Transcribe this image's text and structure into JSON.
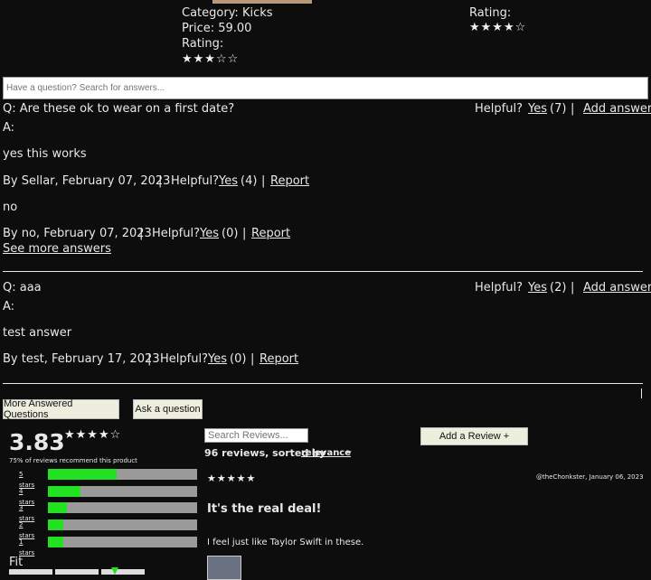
{
  "product": {
    "category": "Category: Kicks",
    "price": "Price: 59.00",
    "rating_label": "Rating:",
    "rating_stars": "★★★☆☆"
  },
  "related": {
    "rating_label": "Rating:",
    "rating_stars": "★★★★☆"
  },
  "qa_search": {
    "placeholder": "Have a question? Search for answers..."
  },
  "questions": [
    {
      "q": "Q: Are these ok to wear on a first date?",
      "helpful": "Helpful?",
      "yes": "Yes",
      "count": "(7)",
      "sep": "|",
      "add": "Add answer",
      "a_label": "A:",
      "answers": [
        {
          "body": "yes this works",
          "by": "By  Sellar, February 07, 2023",
          "sep1": "|",
          "helpful": "Helpful?",
          "yes": "Yes",
          "count": "(4)",
          "sep2": "|",
          "report": "Report"
        },
        {
          "body": "no",
          "by": "By  no, February 07, 2023",
          "sep1": "|",
          "helpful": "Helpful?",
          "yes": "Yes",
          "count": "(0)",
          "sep2": "|",
          "report": "Report"
        }
      ],
      "more": "See more answers"
    },
    {
      "q": "Q: aaa",
      "helpful": "Helpful?",
      "yes": "Yes",
      "count": "(2)",
      "sep": "|",
      "add": "Add answer",
      "a_label": "A:",
      "answers": [
        {
          "body": "test answer",
          "by": "By  test, February 17, 2023",
          "sep1": "|",
          "helpful": "Helpful?",
          "yes": "Yes",
          "count": "(0)",
          "sep2": "|",
          "report": "Report"
        }
      ]
    }
  ],
  "buttons": {
    "more_questions": "More Answered Questions",
    "ask": "Ask a question",
    "add_review": "Add a Review +"
  },
  "ratings": {
    "average": "3.83",
    "stars": "★★★★☆",
    "recommend": "75% of reviews recommend this product",
    "breakdown": [
      {
        "label": "5 stars",
        "fraction": 0.46
      },
      {
        "label": "4 stars",
        "fraction": 0.22
      },
      {
        "label": "3 stars",
        "fraction": 0.13
      },
      {
        "label": "2 stars",
        "fraction": 0.1
      },
      {
        "label": "1 stars",
        "fraction": 0.1
      }
    ],
    "fit_label": "Fit"
  },
  "reviews": {
    "search_placeholder": "Search Reviews...",
    "count_text": "96 reviews, sorted by",
    "sort": "relevance",
    "chevron": "⌄",
    "first": {
      "stars": "★★★★★",
      "user_date": "@theChonkster, January 06, 2023",
      "title": "It's the real deal!",
      "body": "I feel just like Taylor Swift in these."
    }
  },
  "colors": {
    "background": "#0d0d0d",
    "text": "#e8e8e8",
    "bar_fill": "#22e022",
    "bar_track": "#9a9a9a"
  }
}
